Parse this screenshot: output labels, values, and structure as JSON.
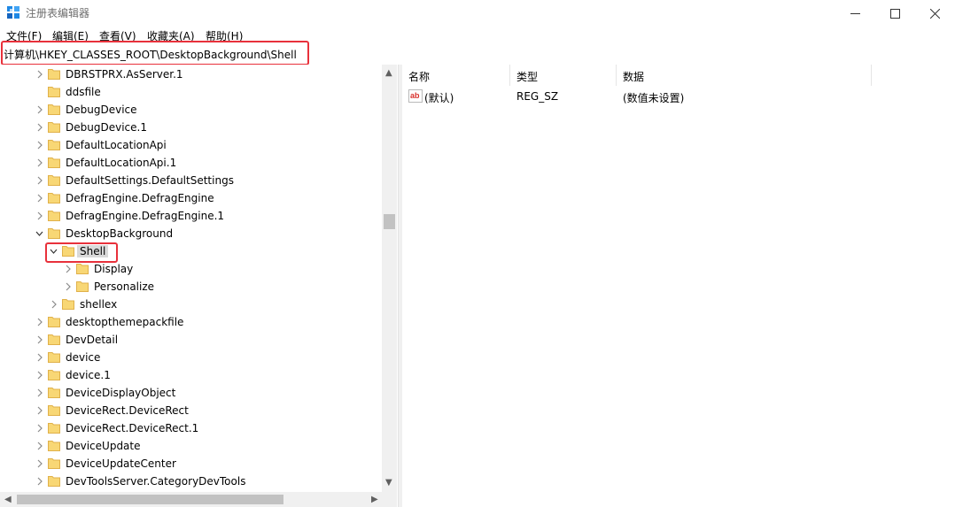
{
  "window": {
    "title": "注册表编辑器"
  },
  "menu": [
    "文件(F)",
    "编辑(E)",
    "查看(V)",
    "收藏夹(A)",
    "帮助(H)"
  ],
  "address": {
    "path": "计算机\\HKEY_CLASSES_ROOT\\DesktopBackground\\Shell"
  },
  "tree": [
    {
      "label": "DBRSTPRX.AsServer.1",
      "level": 0,
      "expander": "collapsed"
    },
    {
      "label": "ddsfile",
      "level": 0,
      "expander": "none"
    },
    {
      "label": "DebugDevice",
      "level": 0,
      "expander": "collapsed"
    },
    {
      "label": "DebugDevice.1",
      "level": 0,
      "expander": "collapsed"
    },
    {
      "label": "DefaultLocationApi",
      "level": 0,
      "expander": "collapsed"
    },
    {
      "label": "DefaultLocationApi.1",
      "level": 0,
      "expander": "collapsed"
    },
    {
      "label": "DefaultSettings.DefaultSettings",
      "level": 0,
      "expander": "collapsed"
    },
    {
      "label": "DefragEngine.DefragEngine",
      "level": 0,
      "expander": "collapsed"
    },
    {
      "label": "DefragEngine.DefragEngine.1",
      "level": 0,
      "expander": "collapsed"
    },
    {
      "label": "DesktopBackground",
      "level": 0,
      "expander": "expanded"
    },
    {
      "label": "Shell",
      "level": 1,
      "expander": "expanded",
      "selected": true
    },
    {
      "label": "Display",
      "level": 2,
      "expander": "collapsed"
    },
    {
      "label": "Personalize",
      "level": 2,
      "expander": "collapsed"
    },
    {
      "label": "shellex",
      "level": 1,
      "expander": "collapsed"
    },
    {
      "label": "desktopthemepackfile",
      "level": 0,
      "expander": "collapsed"
    },
    {
      "label": "DevDetail",
      "level": 0,
      "expander": "collapsed"
    },
    {
      "label": "device",
      "level": 0,
      "expander": "collapsed"
    },
    {
      "label": "device.1",
      "level": 0,
      "expander": "collapsed"
    },
    {
      "label": "DeviceDisplayObject",
      "level": 0,
      "expander": "collapsed"
    },
    {
      "label": "DeviceRect.DeviceRect",
      "level": 0,
      "expander": "collapsed"
    },
    {
      "label": "DeviceRect.DeviceRect.1",
      "level": 0,
      "expander": "collapsed"
    },
    {
      "label": "DeviceUpdate",
      "level": 0,
      "expander": "collapsed"
    },
    {
      "label": "DeviceUpdateCenter",
      "level": 0,
      "expander": "collapsed"
    },
    {
      "label": "DevToolsServer.CategoryDevTools",
      "level": 0,
      "expander": "collapsed"
    }
  ],
  "values_table": {
    "columns": [
      "名称",
      "类型",
      "数据"
    ],
    "rows": [
      {
        "name": "(默认)",
        "type": "REG_SZ",
        "data": "(数值未设置)",
        "icon": "string-value-icon"
      }
    ]
  },
  "colors": {
    "folder": "#f8d775",
    "folder_edge": "#e0b14a",
    "highlight": "#e8313b",
    "selected_bg": "#d9d9d9"
  }
}
